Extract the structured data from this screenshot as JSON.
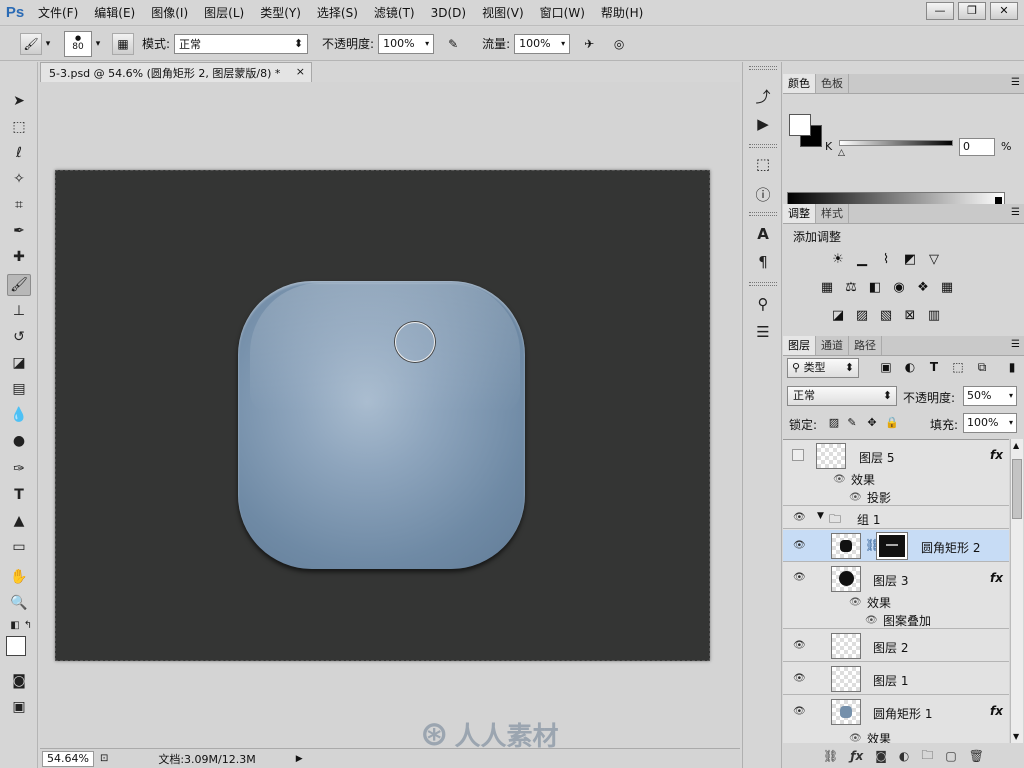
{
  "app": {
    "logo": "Ps"
  },
  "menus": [
    "文件(F)",
    "编辑(E)",
    "图像(I)",
    "图层(L)",
    "类型(Y)",
    "选择(S)",
    "滤镜(T)",
    "3D(D)",
    "视图(V)",
    "窗口(W)",
    "帮助(H)"
  ],
  "window_buttons": {
    "minimize": "—",
    "restore": "❐",
    "close": "✕"
  },
  "options": {
    "brush_size": "80",
    "mode_label": "模式:",
    "mode_value": "正常",
    "opacity_label": "不透明度:",
    "opacity_value": "100%",
    "flow_label": "流量:",
    "flow_value": "100%"
  },
  "document": {
    "tab_title": "5-3.psd @ 54.6% (圆角矩形 2, 图层蒙版/8) *",
    "close": "×",
    "zoom": "54.64%",
    "doc_size": "文档:3.09M/12.3M"
  },
  "watermark": {
    "text": "人人素材"
  },
  "color_panel": {
    "tabs": [
      "颜色",
      "色板"
    ],
    "channel_label": "K",
    "channel_value": "0",
    "unit": "%",
    "colors": {
      "foreground": "#ffffff",
      "background": "#000000"
    }
  },
  "adjustments_panel": {
    "tabs": [
      "调整",
      "样式"
    ],
    "title": "添加调整"
  },
  "layers_panel": {
    "tabs": [
      "图层",
      "通道",
      "路径"
    ],
    "filter_label": "类型",
    "blend_mode": "正常",
    "opacity_label": "不透明度:",
    "opacity_value": "50%",
    "lock_label": "锁定:",
    "fill_label": "填充:",
    "fill_value": "100%",
    "layers": [
      {
        "name": "图层 5",
        "fx": "fx",
        "visible": false
      },
      {
        "name": "效果"
      },
      {
        "name": "投影"
      },
      {
        "name": "组 1",
        "visible": true
      },
      {
        "name": "圆角矩形 2",
        "visible": true,
        "selected": true
      },
      {
        "name": "图层 3",
        "fx": "fx",
        "visible": true
      },
      {
        "name": "效果"
      },
      {
        "name": "图案叠加"
      },
      {
        "name": "图层 2",
        "visible": true
      },
      {
        "name": "图层 1",
        "visible": true
      },
      {
        "name": "圆角矩形 1",
        "fx": "fx",
        "visible": true
      },
      {
        "name": "效果"
      }
    ]
  },
  "accent_colors": {
    "knob": "#7590ab",
    "canvas": "#343534",
    "selection": "#c7dcf5"
  }
}
